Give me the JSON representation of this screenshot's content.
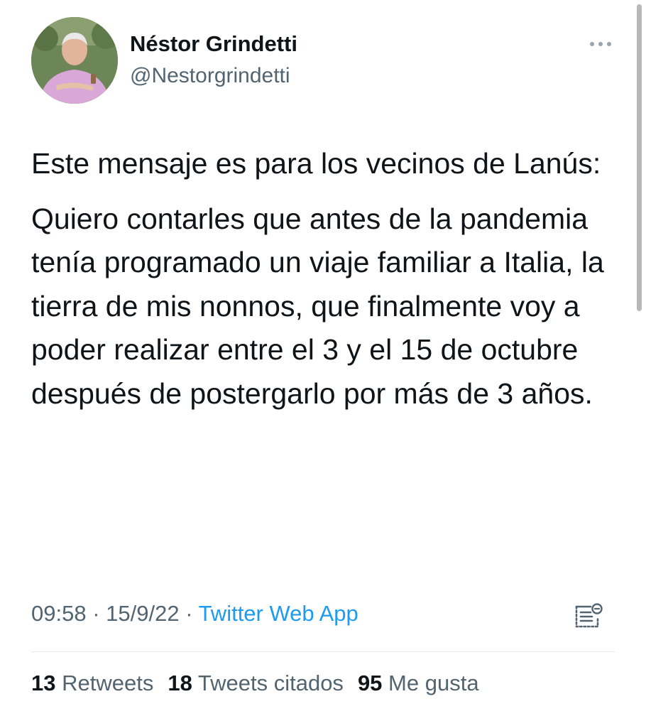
{
  "author": {
    "name": "Néstor Grindetti",
    "handle": "@Nestorgrindetti"
  },
  "tweet": {
    "paragraph1": "Este mensaje es para los vecinos de Lanús:",
    "paragraph2": "Quiero contarles que antes de la pandemia tenía programado un viaje familiar a Italia, la tierra de mis nonnos, que finalmente voy a poder realizar entre el 3 y el 15 de octubre después de postergarlo por más de 3 años."
  },
  "meta": {
    "time": "09:58",
    "separator1": " · ",
    "date": "15/9/22",
    "separator2": " · ",
    "source": "Twitter Web App"
  },
  "stats": {
    "retweets_count": "13",
    "retweets_label": "Retweets",
    "quotes_count": "18",
    "quotes_label": "Tweets citados",
    "likes_count": "95",
    "likes_label": "Me gusta"
  },
  "icons": {
    "more": "more-options-icon",
    "analytics": "tweet-analytics-icon"
  },
  "colors": {
    "link": "#1d9bf0",
    "secondary_text": "#536471",
    "primary_text": "#0f1419"
  }
}
